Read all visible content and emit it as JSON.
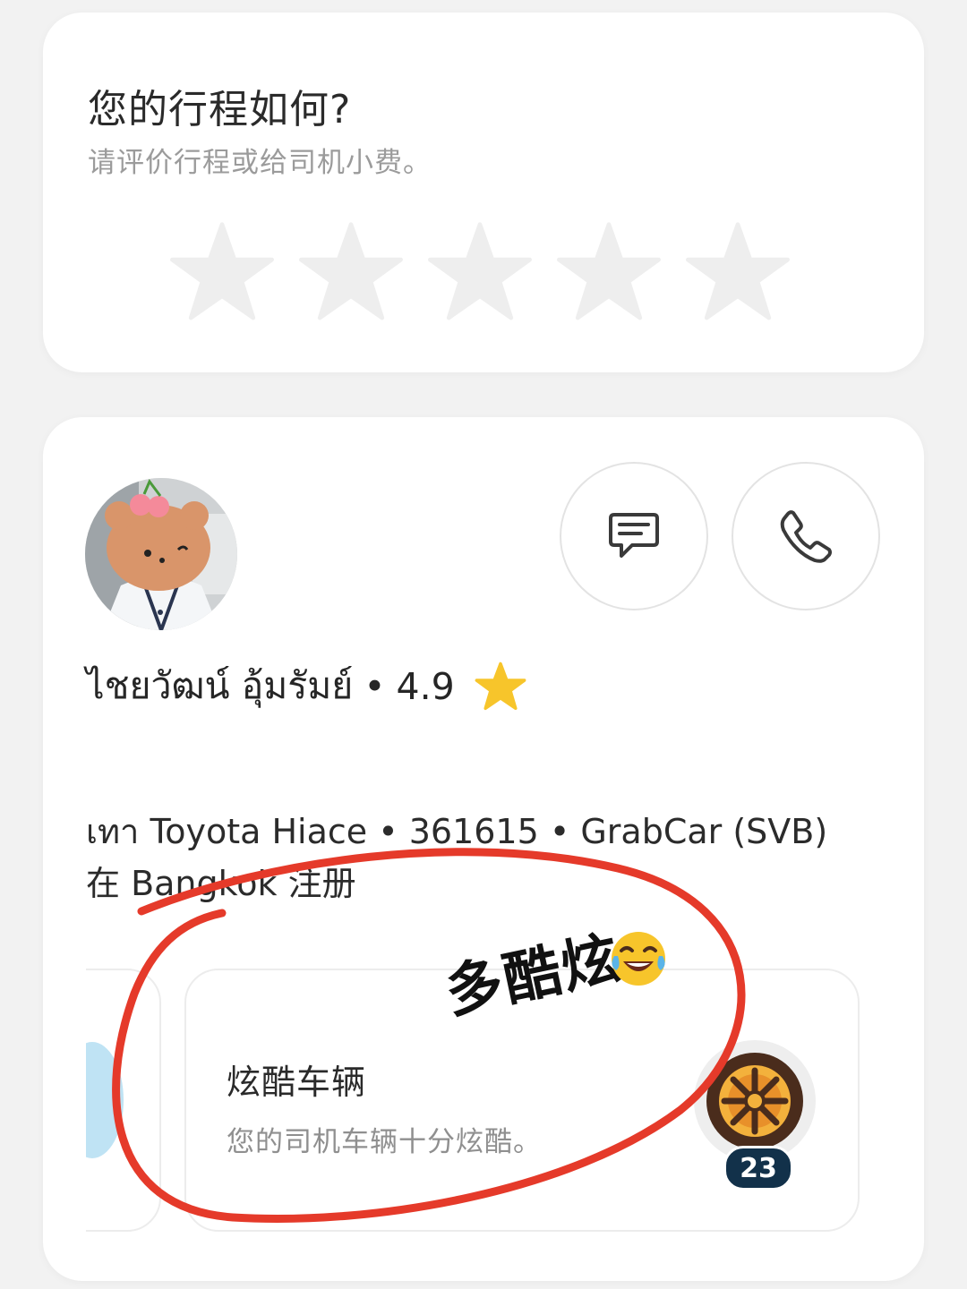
{
  "rating_card": {
    "title": "您的行程如何?",
    "subtitle": "请评价行程或给司机小费。",
    "stars": [
      {
        "icon": "star-outline-icon",
        "filled": false
      },
      {
        "icon": "star-outline-icon",
        "filled": false
      },
      {
        "icon": "star-outline-icon",
        "filled": false
      },
      {
        "icon": "star-outline-icon",
        "filled": false
      },
      {
        "icon": "star-outline-icon",
        "filled": false
      }
    ],
    "star_color": "#eeeeee"
  },
  "driver": {
    "name": "ไชยวัฒน์ อุ้มรัมย์",
    "separator": "•",
    "rating": "4.9",
    "rating_star_color": "#f7c52b",
    "vehicle": "เทา Toyota Hiace • 361615 • GrabCar (SVB)",
    "registration": "在 Bangkok 注册",
    "actions": {
      "chat_icon": "chat-bubble-icon",
      "call_icon": "phone-icon"
    }
  },
  "compliment": {
    "title": "炫酷车辆",
    "description": "您的司机车辆十分炫酷。",
    "badge_icon": "wheel-icon",
    "count": "23"
  },
  "annotation": {
    "text": "多酷炫",
    "emoji": "laughing-tears-emoji",
    "circle_color": "#e53a2a"
  },
  "colors": {
    "background": "#f2f2f2",
    "card": "#ffffff",
    "badge": "#12314a"
  }
}
